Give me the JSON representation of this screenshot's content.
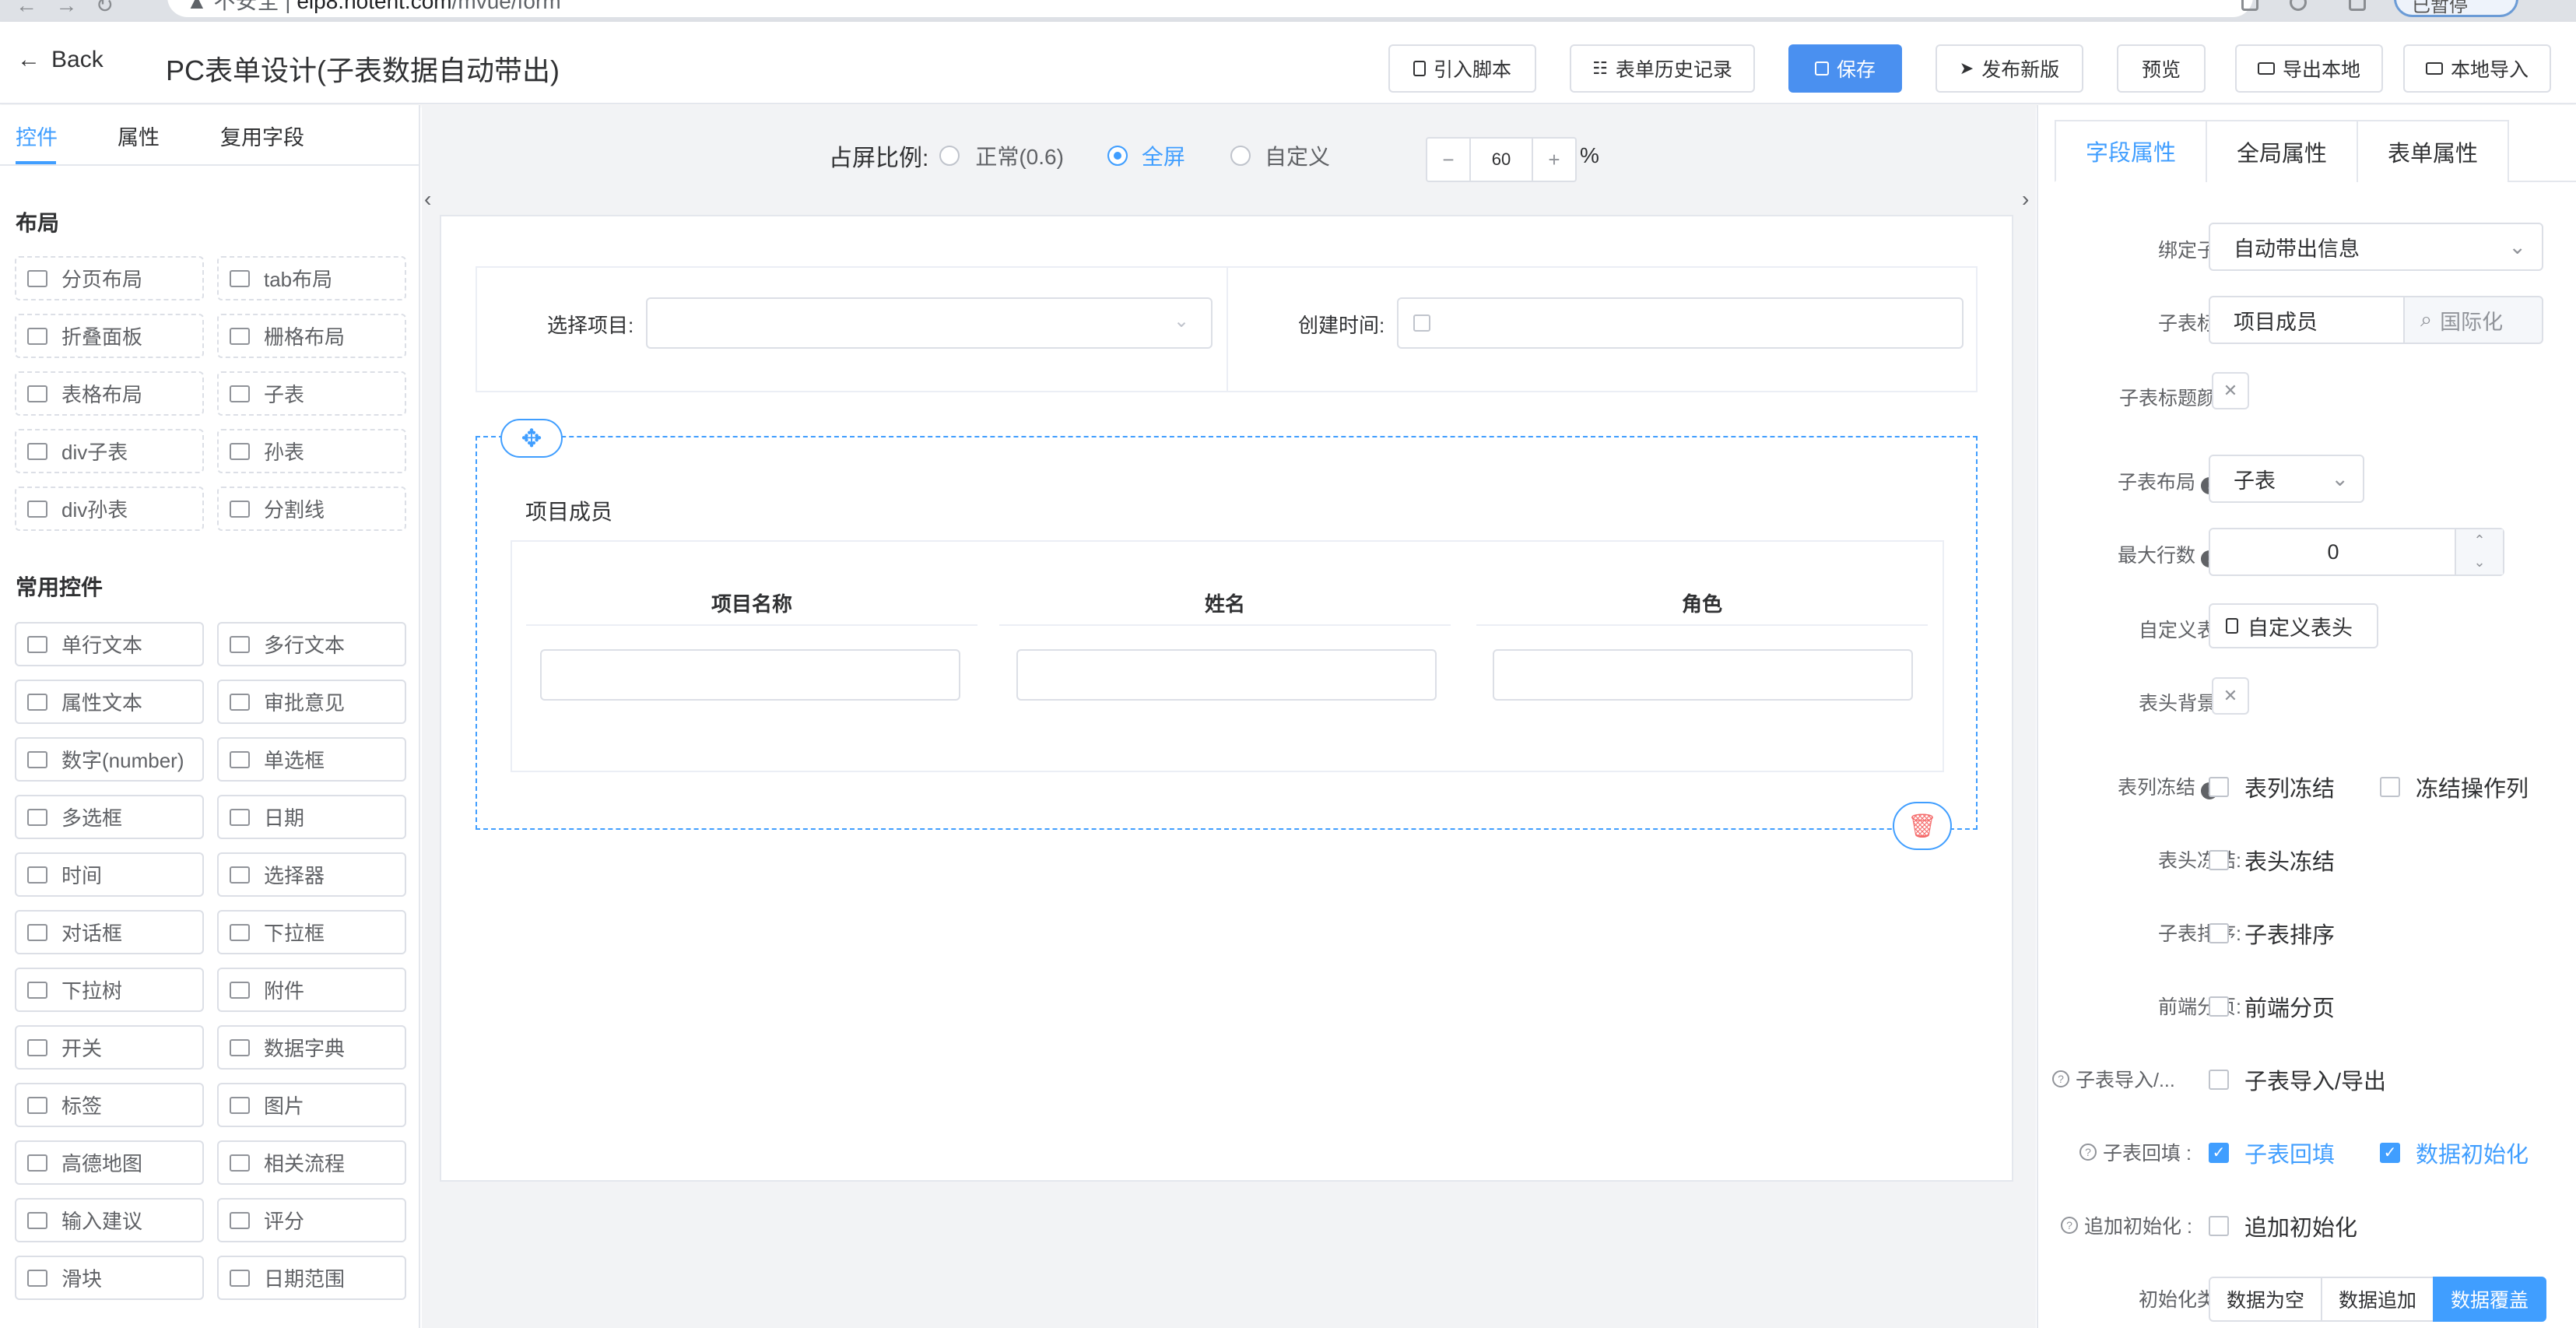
{
  "browser": {
    "security": "不安全",
    "host": "eip8.hotent.com",
    "path": "/mvue/form",
    "profile_label": "已暂停"
  },
  "header": {
    "back_label": "Back",
    "title": "PC表单设计(子表数据自动带出)",
    "buttons": {
      "import_script": "引入脚本",
      "history": "表单历史记录",
      "save": "保存",
      "publish": "发布新版",
      "preview": "预览",
      "export_local": "导出本地",
      "import_local": "本地导入"
    }
  },
  "left": {
    "tabs": [
      "控件",
      "属性",
      "复用字段"
    ],
    "layout_title": "布局",
    "layout_items": [
      "分页布局",
      "tab布局",
      "折叠面板",
      "栅格布局",
      "表格布局",
      "子表",
      "div子表",
      "孙表",
      "div孙表",
      "分割线"
    ],
    "common_title": "常用控件",
    "common_items": [
      "单行文本",
      "多行文本",
      "属性文本",
      "审批意见",
      "数字(number)",
      "单选框",
      "多选框",
      "日期",
      "时间",
      "选择器",
      "对话框",
      "下拉框",
      "下拉树",
      "附件",
      "开关",
      "数据字典",
      "标签",
      "图片",
      "高德地图",
      "相关流程",
      "输入建议",
      "评分",
      "滑块",
      "日期范围"
    ]
  },
  "center": {
    "ratio_label": "占屏比例:",
    "ratio_options": [
      "正常(0.6)",
      "全屏",
      "自定义"
    ],
    "ratio_selected": "全屏",
    "custom_value": "60",
    "percent": "%",
    "minus": "−",
    "plus": "+",
    "field_select_label": "选择项目:",
    "field_time_label": "创建时间:",
    "subtable_title": "项目成员",
    "columns": [
      "项目名称",
      "姓名",
      "角色"
    ]
  },
  "right": {
    "tabs": [
      "字段属性",
      "全局属性",
      "表单属性"
    ],
    "bind_label": "绑定子表:",
    "bind_value": "自动带出信息",
    "title_label": "子表标题:",
    "title_value": "项目成员",
    "i18n_label": "国际化",
    "title_color_label": "子表标题颜色:",
    "layout_label": "子表布局",
    "layout_value": "子表",
    "maxrows_label": "最大行数",
    "maxrows_value": "0",
    "custom_header_label": "自定义表头:",
    "custom_header_btn": "自定义表头",
    "header_bg_label": "表头背景色:",
    "col_freeze_label": "表列冻结",
    "col_freeze_opt": "表列冻结",
    "op_freeze_opt": "冻结操作列",
    "head_freeze_label": "表头冻结:",
    "head_freeze_opt": "表头冻结",
    "sort_label": "子表排序:",
    "sort_opt": "子表排序",
    "paging_label": "前端分页:",
    "paging_opt": "前端分页",
    "import_label": "子表导入/...",
    "import_opt": "子表导入/导出",
    "backfill_label": "子表回填 :",
    "backfill_opt": "子表回填",
    "datainit_opt": "数据初始化",
    "append_label": "追加初始化 :",
    "append_opt": "追加初始化",
    "init_type_label": "初始化类型:",
    "init_types": [
      "数据为空",
      "数据追加",
      "数据覆盖"
    ],
    "init_selected": "数据覆盖"
  },
  "colors": {
    "accent": "#409eff",
    "primary_button": "#4a90f0",
    "danger": "#f56c6c"
  }
}
